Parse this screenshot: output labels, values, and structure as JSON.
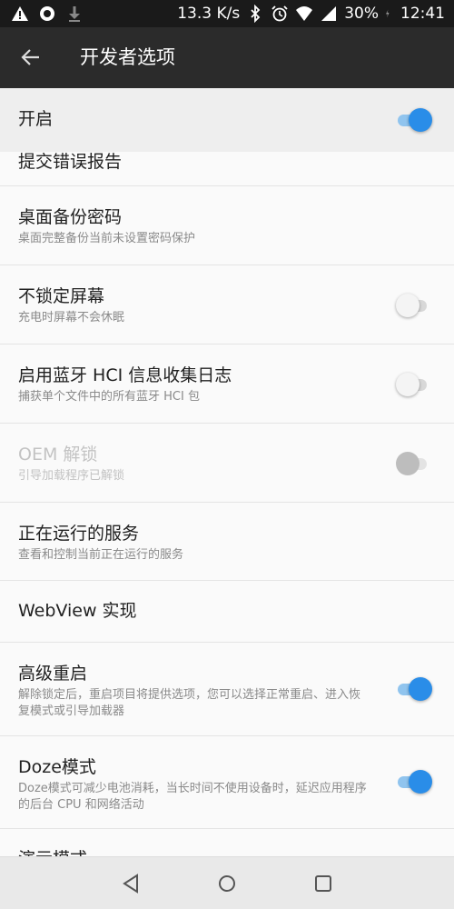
{
  "status_bar": {
    "speed": "13.3 K/s",
    "battery": "30%",
    "time": "12:41"
  },
  "toolbar": {
    "title": "开发者选项"
  },
  "master": {
    "label": "开启",
    "enabled": true
  },
  "items": [
    {
      "title": "提交错误报告",
      "subtitle": "",
      "switch": "none"
    },
    {
      "title": "桌面备份密码",
      "subtitle": "桌面完整备份当前未设置密码保护",
      "switch": "none"
    },
    {
      "title": "不锁定屏幕",
      "subtitle": "充电时屏幕不会休眠",
      "switch": "off"
    },
    {
      "title": "启用蓝牙 HCI 信息收集日志",
      "subtitle": "捕获单个文件中的所有蓝牙 HCI 包",
      "switch": "off"
    },
    {
      "title": "OEM 解锁",
      "subtitle": "引导加载程序已解锁",
      "switch": "disabled"
    },
    {
      "title": "正在运行的服务",
      "subtitle": "查看和控制当前正在运行的服务",
      "switch": "none"
    },
    {
      "title": "WebView 实现",
      "subtitle": "",
      "switch": "none"
    },
    {
      "title": "高级重启",
      "subtitle": "解除锁定后，重启项目将提供选项，您可以选择正常重启、进入恢复模式或引导加载器",
      "switch": "on"
    },
    {
      "title": "Doze模式",
      "subtitle": "Doze模式可减少电池消耗，当长时间不使用设备时，延迟应用程序的后台 CPU 和网络活动",
      "switch": "on"
    },
    {
      "title": "演示模式",
      "subtitle": "",
      "switch": "none"
    }
  ],
  "colors": {
    "accent": "#2a8de8",
    "toolbar": "#2b2b2b",
    "statusbar": "#1a1a1a"
  }
}
